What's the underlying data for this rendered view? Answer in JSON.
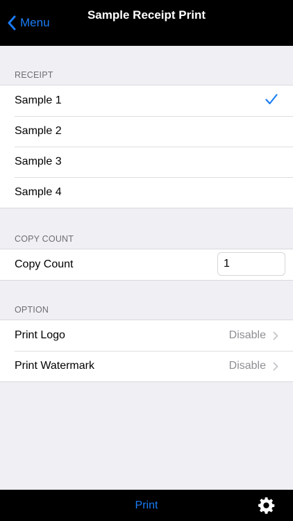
{
  "navbar": {
    "back_label": "Menu",
    "title": "Sample Receipt Print"
  },
  "receipt_section": {
    "header": "RECEIPT",
    "items": [
      {
        "label": "Sample 1",
        "selected": true
      },
      {
        "label": "Sample 2",
        "selected": false
      },
      {
        "label": "Sample 3",
        "selected": false
      },
      {
        "label": "Sample 4",
        "selected": false
      }
    ]
  },
  "copy_section": {
    "header": "COPY COUNT",
    "label": "Copy Count",
    "value": "1"
  },
  "option_section": {
    "header": "OPTION",
    "items": [
      {
        "label": "Print Logo",
        "value": "Disable"
      },
      {
        "label": "Print Watermark",
        "value": "Disable"
      }
    ]
  },
  "toolbar": {
    "print_label": "Print",
    "settings_icon": "gear-icon"
  },
  "colors": {
    "accent": "#1a7cf5",
    "navbar_bg": "#000000",
    "background": "#efeff4",
    "secondary_text": "#8e8e93",
    "section_header": "#6d6d72"
  }
}
